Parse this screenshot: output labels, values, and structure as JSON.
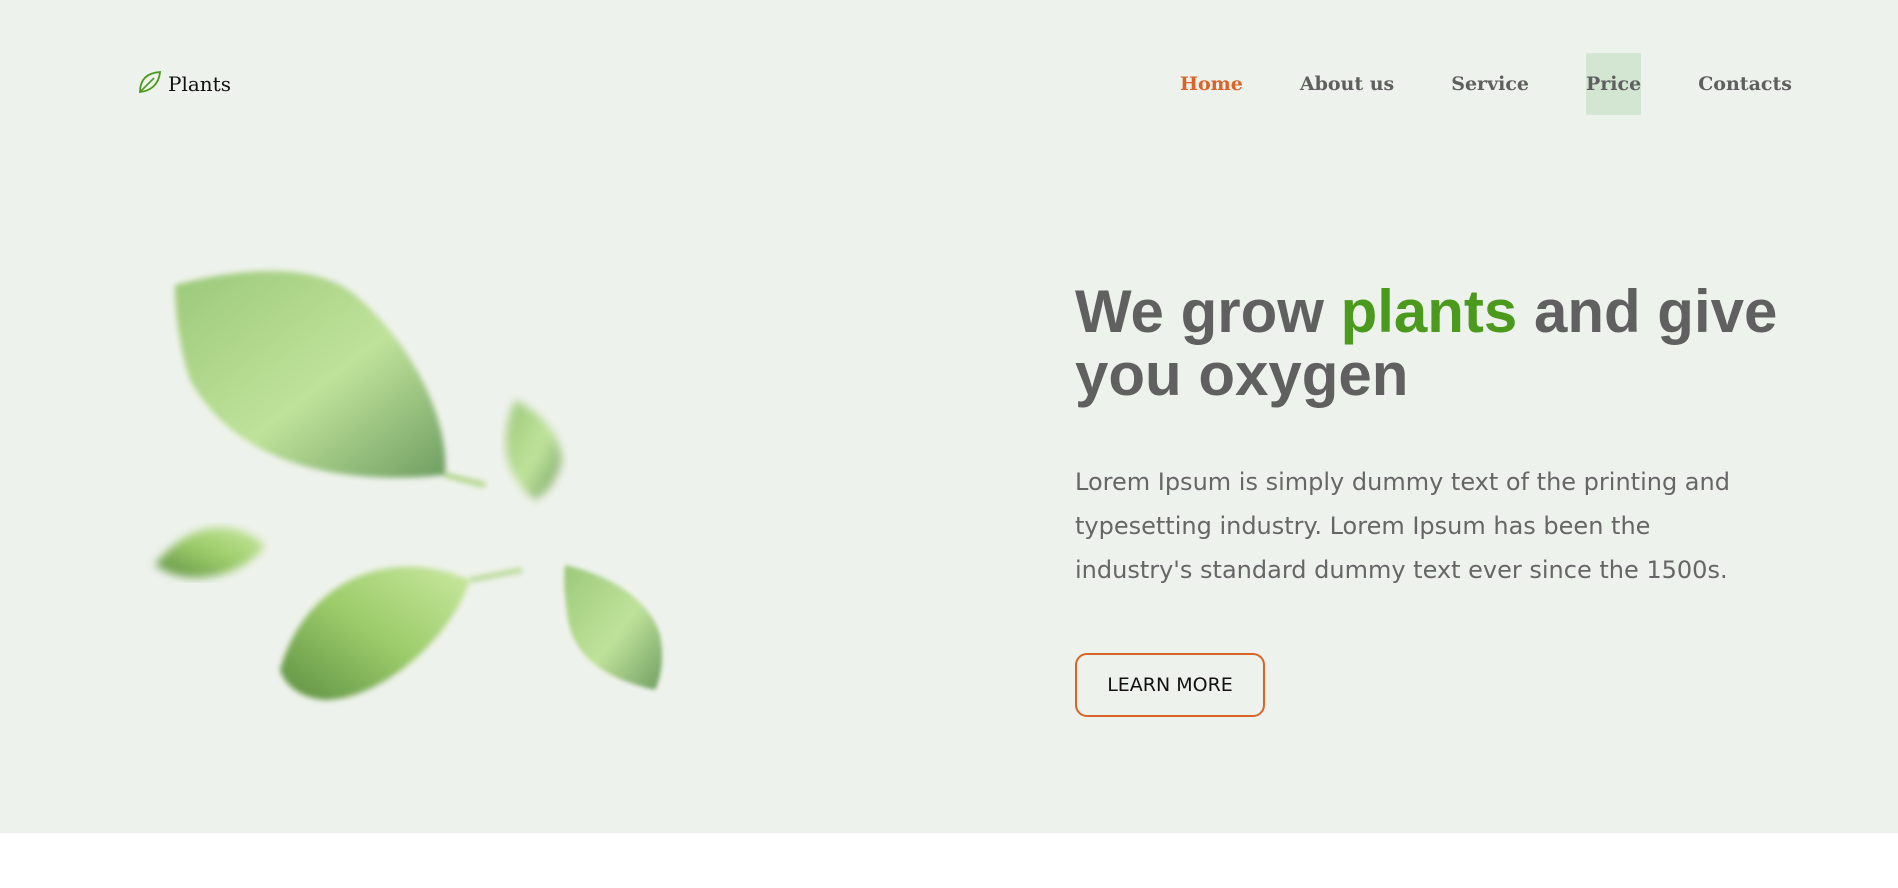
{
  "brand": {
    "name": "Plants",
    "icon": "leaf-icon",
    "color": "#4b9a1e"
  },
  "nav": {
    "items": [
      {
        "label": "Home",
        "state": "active"
      },
      {
        "label": "About us",
        "state": ""
      },
      {
        "label": "Service",
        "state": ""
      },
      {
        "label": "Price",
        "state": "hover"
      },
      {
        "label": "Contacts",
        "state": ""
      }
    ]
  },
  "hero": {
    "headline_before": "We grow ",
    "headline_accent": "plants",
    "headline_after": " and give you oxygen",
    "body": "Lorem Ipsum is simply dummy text of the printing and typesetting industry. Lorem Ipsum has been the industry's standard dummy text ever since the 1500s.",
    "cta_label": "LEARN MORE"
  },
  "colors": {
    "background": "#eef2ec",
    "accent_orange": "#d9642a",
    "accent_green": "#4b9a1e",
    "text_gray": "#606060",
    "hover_bg": "#d3e6d1"
  }
}
